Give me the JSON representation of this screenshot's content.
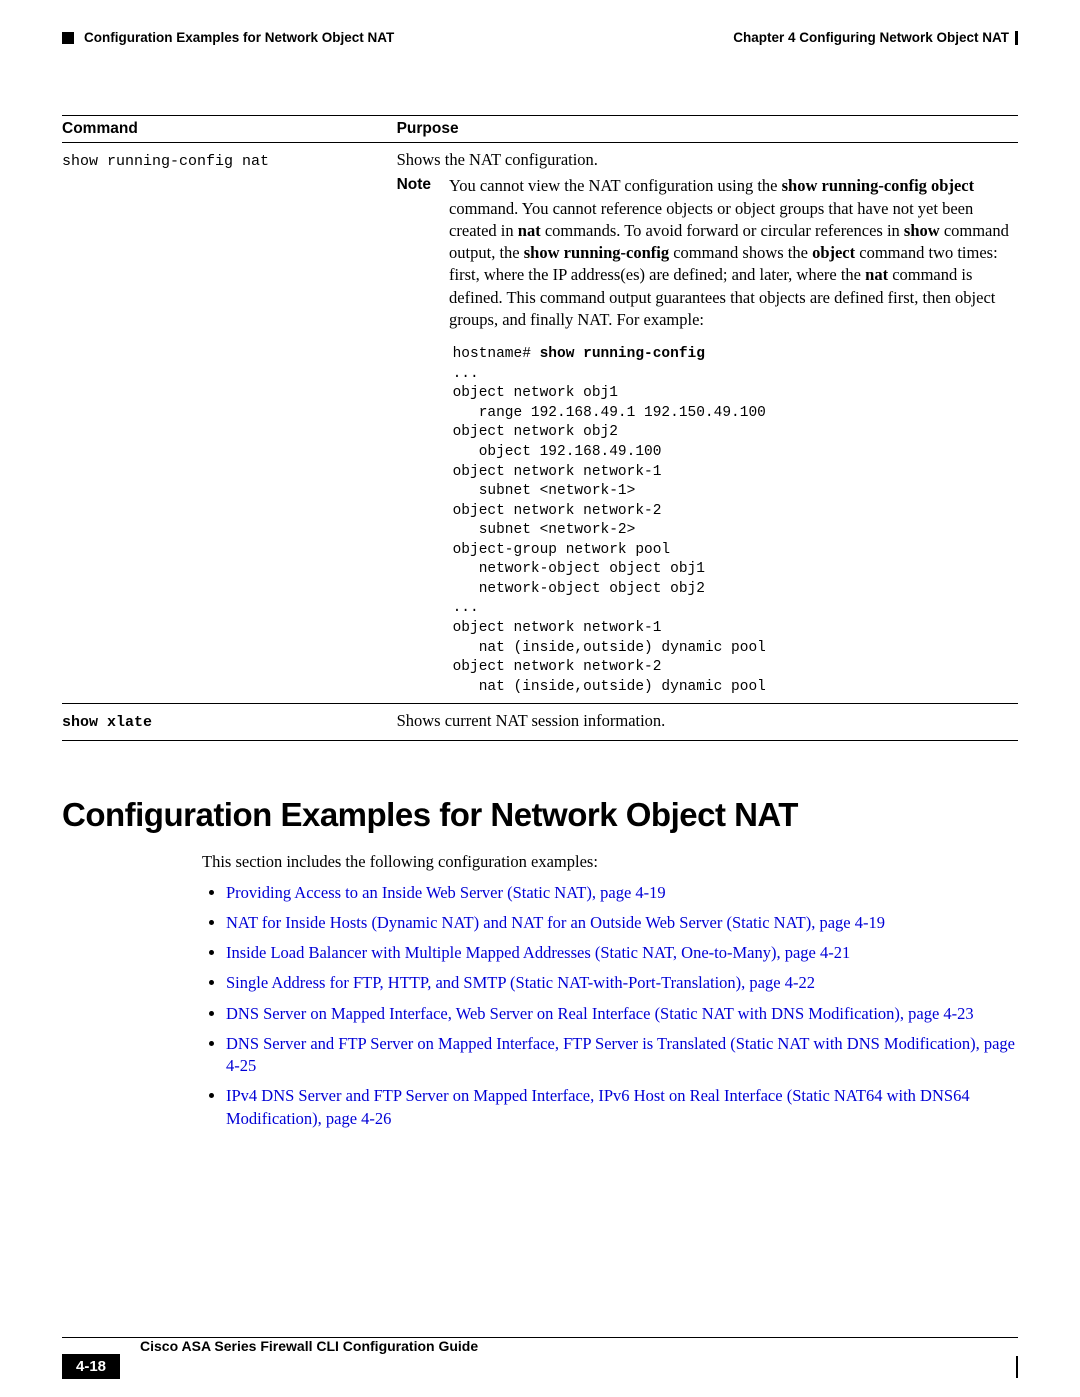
{
  "header": {
    "left": "Configuration Examples for Network Object NAT",
    "right_chapter": "Chapter 4    Configuring Network Object NAT"
  },
  "table": {
    "head": {
      "c1": "Command",
      "c2": "Purpose"
    },
    "row1": {
      "cmd": "show running-config nat",
      "desc": "Shows the NAT configuration.",
      "note_label": "Note",
      "note_pre": "You cannot view the NAT configuration using the ",
      "note_b1": "show running-config object",
      "note_mid1": " command. You cannot reference objects or object groups that have not yet been created in ",
      "note_b2": "nat",
      "note_mid2": " commands. To avoid forward or circular references in ",
      "note_b3": "show",
      "note_mid3": " command output, the ",
      "note_b4": "show running-config",
      "note_mid4": " command shows the ",
      "note_b5": "object",
      "note_mid5": " command two times: first, where the IP address(es) are defined; and later, where the ",
      "note_b6": "nat",
      "note_post": " command is defined. This command output guarantees that objects are defined first, then object groups, and finally NAT. For example:",
      "code_prefix": "hostname# ",
      "code_cmd": "show running-config",
      "code_body": "...\nobject network obj1\n   range 192.168.49.1 192.150.49.100\nobject network obj2\n   object 192.168.49.100\nobject network network-1\n   subnet <network-1>\nobject network network-2\n   subnet <network-2>\nobject-group network pool\n   network-object object obj1\n   network-object object obj2\n...\nobject network network-1\n   nat (inside,outside) dynamic pool\nobject network network-2\n   nat (inside,outside) dynamic pool"
    },
    "row2": {
      "cmd": "show xlate",
      "desc": "Shows current NAT session information."
    }
  },
  "section": {
    "title": "Configuration Examples for Network Object NAT",
    "intro": "This section includes the following configuration examples:",
    "links": [
      "Providing Access to an Inside Web Server (Static NAT), page 4-19",
      "NAT for Inside Hosts (Dynamic NAT) and NAT for an Outside Web Server (Static NAT), page 4-19",
      "Inside Load Balancer with Multiple Mapped Addresses (Static NAT, One-to-Many), page 4-21",
      "Single Address for FTP, HTTP, and SMTP (Static NAT-with-Port-Translation), page 4-22",
      "DNS Server on Mapped Interface, Web Server on Real Interface (Static NAT with DNS Modification), page 4-23",
      "DNS Server and FTP Server on Mapped Interface, FTP Server is Translated (Static NAT with DNS Modification), page 4-25",
      "IPv4 DNS Server and FTP Server on Mapped Interface, IPv6 Host on Real Interface (Static NAT64 with DNS64 Modification), page 4-26"
    ]
  },
  "footer": {
    "guide": "Cisco ASA Series Firewall CLI Configuration Guide",
    "page": "4-18"
  }
}
